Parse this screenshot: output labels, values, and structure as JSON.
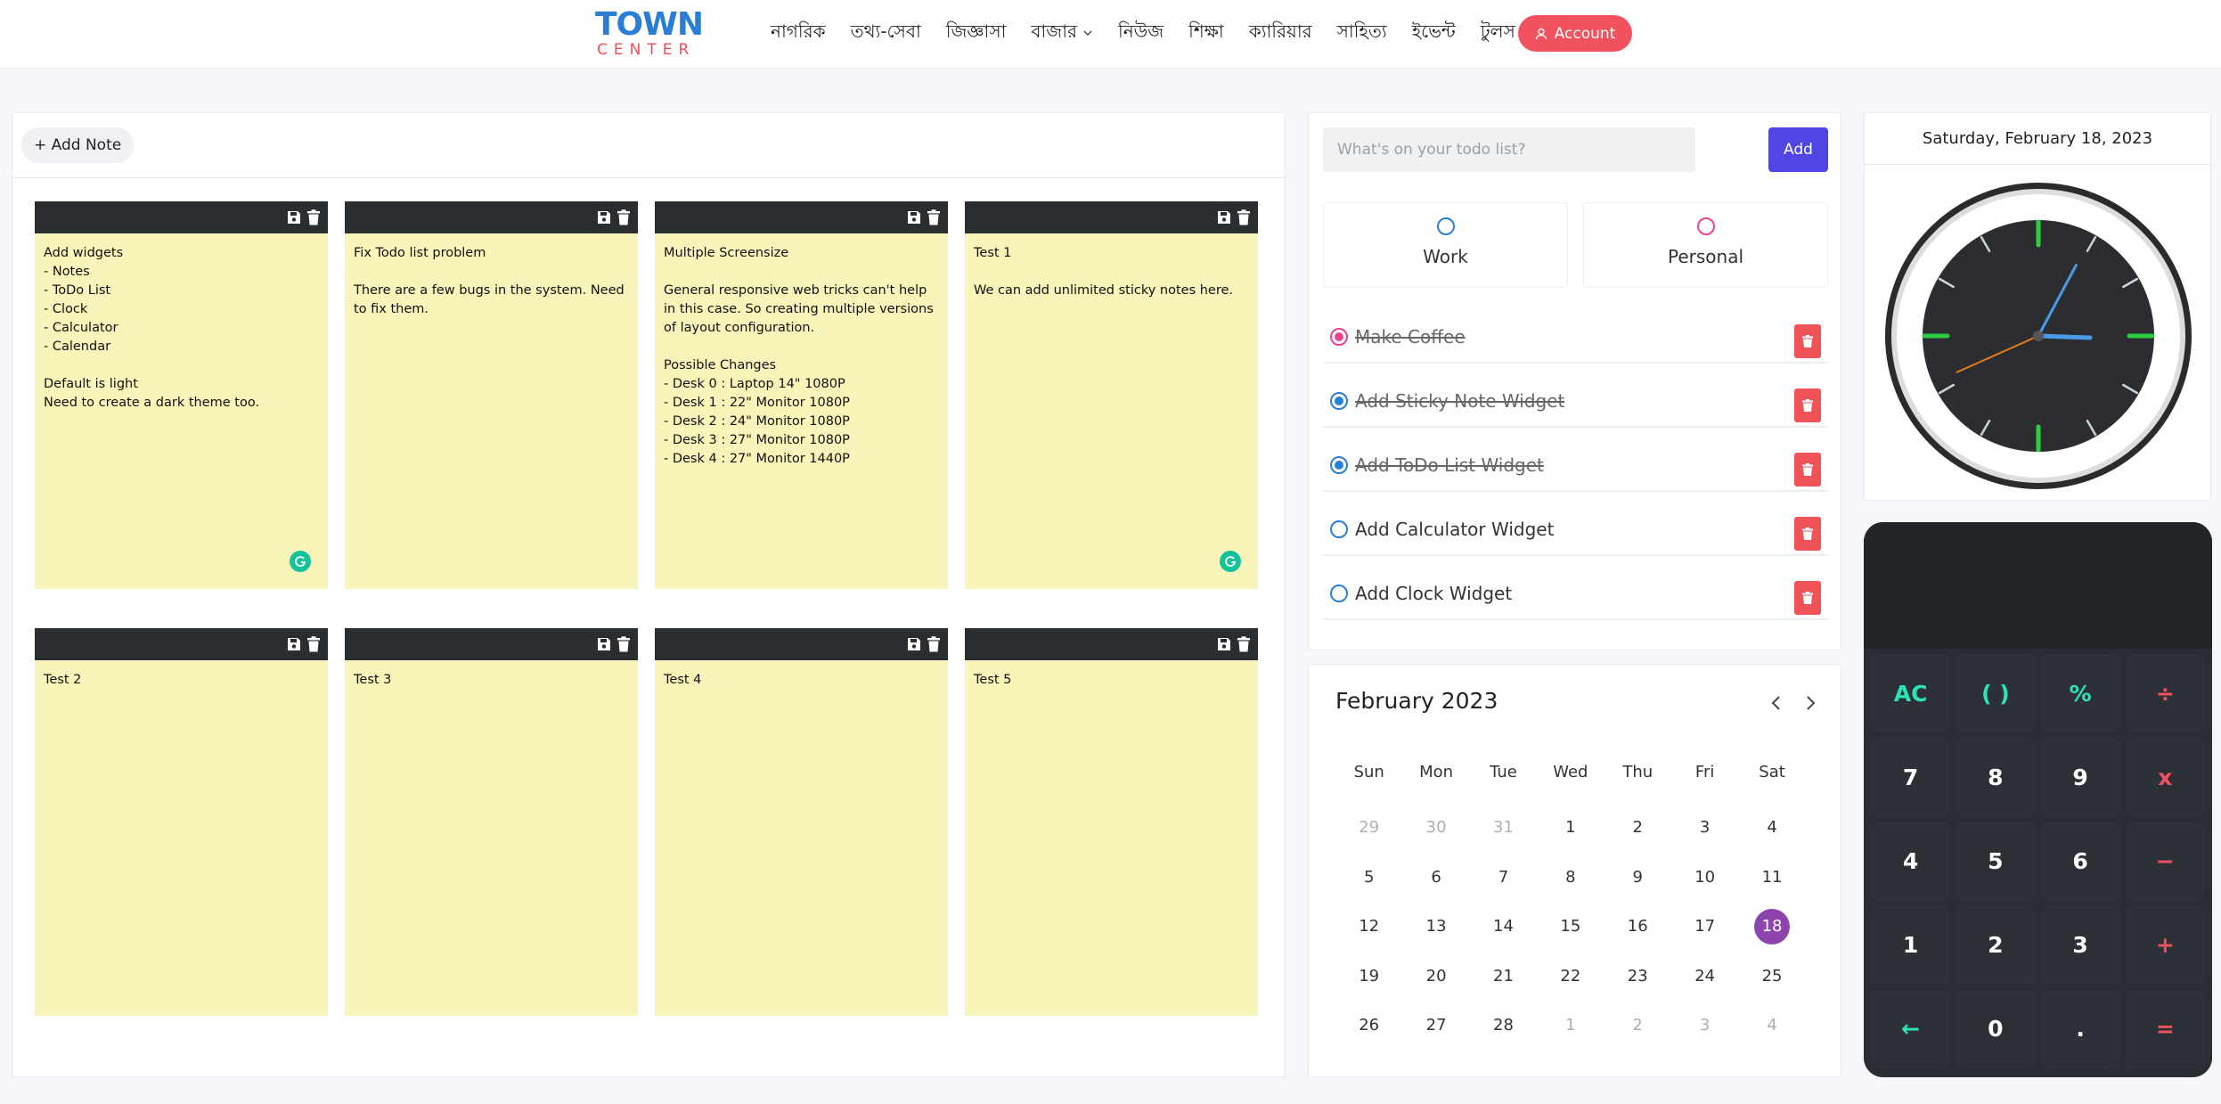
{
  "header": {
    "logo_top": "TOWN",
    "logo_bottom": "CENTER",
    "nav": [
      {
        "label": "নাগরিক",
        "dropdown": false
      },
      {
        "label": "তথ্য-সেবা",
        "dropdown": false
      },
      {
        "label": "জিজ্ঞাসা",
        "dropdown": false
      },
      {
        "label": "বাজার",
        "dropdown": true
      },
      {
        "label": "নিউজ",
        "dropdown": false
      },
      {
        "label": "শিক্ষা",
        "dropdown": false
      },
      {
        "label": "ক্যারিয়ার",
        "dropdown": false
      },
      {
        "label": "সাহিত্য",
        "dropdown": false
      },
      {
        "label": "ইভেন্ট",
        "dropdown": false
      },
      {
        "label": "টুলস",
        "dropdown": true
      }
    ],
    "account_label": "Account",
    "colors": {
      "logo_blue": "#2a7fd4",
      "accent": "#f1525d"
    }
  },
  "notes": {
    "add_note_label": "+ Add Note",
    "items": [
      {
        "text": "Add widgets\n- Notes\n- ToDo List\n- Clock\n- Calculator\n- Calendar\n\nDefault is light\nNeed to create a dark theme too.",
        "badge": "grammarly-icon"
      },
      {
        "text": "Fix Todo list problem\n\nThere are a few bugs in the system. Need to fix them.",
        "badge": ""
      },
      {
        "text": "Multiple Screensize\n\nGeneral responsive web tricks can't help in this case. So creating multiple versions of layout configuration.\n\nPossible Changes\n- Desk 0 : Laptop 14\" 1080P\n- Desk 1 : 22\" Monitor 1080P\n- Desk 2 : 24\" Monitor 1080P\n- Desk 3 : 27\" Monitor 1080P\n- Desk 4 : 27\" Monitor 1440P",
        "badge": ""
      },
      {
        "text": "Test 1\n\nWe can add unlimited sticky notes here.",
        "badge": "grammarly-icon"
      },
      {
        "text": "Test 2",
        "badge": ""
      },
      {
        "text": "Test 3",
        "badge": ""
      },
      {
        "text": "Test 4",
        "badge": ""
      },
      {
        "text": "Test 5",
        "badge": ""
      }
    ],
    "note_color": "#f9f4b9"
  },
  "todo": {
    "placeholder": "What's on your todo list?",
    "add_label": "Add",
    "categories": [
      {
        "label": "Work",
        "color": "#2a7fd4"
      },
      {
        "label": "Personal",
        "color": "#e84393"
      }
    ],
    "items": [
      {
        "text": "Make Coffee",
        "done": true,
        "category": "Personal"
      },
      {
        "text": "Add Sticky Note Widget",
        "done": true,
        "category": "Work"
      },
      {
        "text": "Add ToDo List Widget",
        "done": true,
        "category": "Work"
      },
      {
        "text": "Add Calculator Widget",
        "done": false,
        "category": "Work"
      },
      {
        "text": "Add Clock Widget",
        "done": false,
        "category": "Work"
      }
    ]
  },
  "calendar": {
    "title": "February 2023",
    "weekdays": [
      "Sun",
      "Mon",
      "Tue",
      "Wed",
      "Thu",
      "Fri",
      "Sat"
    ],
    "weeks": [
      [
        {
          "d": "29",
          "m": true
        },
        {
          "d": "30",
          "m": true
        },
        {
          "d": "31",
          "m": true
        },
        {
          "d": "1"
        },
        {
          "d": "2"
        },
        {
          "d": "3"
        },
        {
          "d": "4"
        }
      ],
      [
        {
          "d": "5"
        },
        {
          "d": "6"
        },
        {
          "d": "7"
        },
        {
          "d": "8"
        },
        {
          "d": "9"
        },
        {
          "d": "10"
        },
        {
          "d": "11"
        }
      ],
      [
        {
          "d": "12"
        },
        {
          "d": "13"
        },
        {
          "d": "14"
        },
        {
          "d": "15"
        },
        {
          "d": "16"
        },
        {
          "d": "17"
        },
        {
          "d": "18",
          "today": true
        }
      ],
      [
        {
          "d": "19"
        },
        {
          "d": "20"
        },
        {
          "d": "21"
        },
        {
          "d": "22"
        },
        {
          "d": "23"
        },
        {
          "d": "24"
        },
        {
          "d": "25"
        }
      ],
      [
        {
          "d": "26"
        },
        {
          "d": "27"
        },
        {
          "d": "28"
        },
        {
          "d": "1",
          "m": true
        },
        {
          "d": "2",
          "m": true
        },
        {
          "d": "3",
          "m": true
        },
        {
          "d": "4",
          "m": true
        }
      ]
    ],
    "today_color": "#8e44ad"
  },
  "clock": {
    "date": "Saturday, February 18, 2023",
    "hours": 3,
    "minutes": 4,
    "seconds": 41
  },
  "calculator": {
    "display": "",
    "keys": [
      {
        "label": "AC",
        "style": "teal"
      },
      {
        "label": "( )",
        "style": "teal"
      },
      {
        "label": "%",
        "style": "teal"
      },
      {
        "label": "÷",
        "style": "red"
      },
      {
        "label": "7",
        "style": ""
      },
      {
        "label": "8",
        "style": ""
      },
      {
        "label": "9",
        "style": ""
      },
      {
        "label": "x",
        "style": "red"
      },
      {
        "label": "4",
        "style": ""
      },
      {
        "label": "5",
        "style": ""
      },
      {
        "label": "6",
        "style": ""
      },
      {
        "label": "−",
        "style": "red"
      },
      {
        "label": "1",
        "style": ""
      },
      {
        "label": "2",
        "style": ""
      },
      {
        "label": "3",
        "style": ""
      },
      {
        "label": "+",
        "style": "red"
      },
      {
        "label": "←",
        "style": "teal"
      },
      {
        "label": "0",
        "style": ""
      },
      {
        "label": ".",
        "style": ""
      },
      {
        "label": "=",
        "style": "red"
      }
    ]
  }
}
